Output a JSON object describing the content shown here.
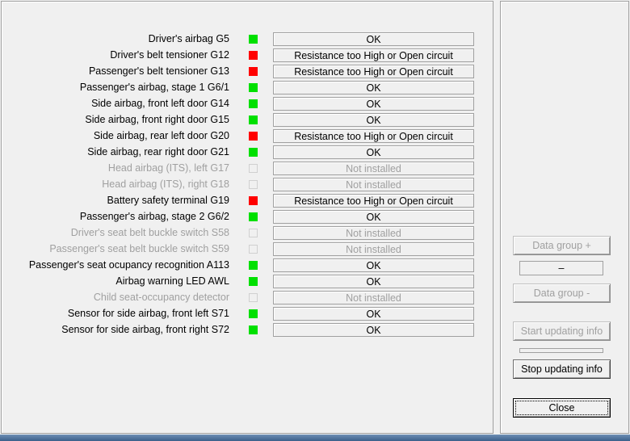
{
  "colors": {
    "ok": "#00e000",
    "error": "#ff0000",
    "not_installed": "#f0f0f0"
  },
  "rows": [
    {
      "label": "Driver's airbag G5",
      "status": "ok",
      "value": "OK"
    },
    {
      "label": "Driver's belt tensioner G12",
      "status": "error",
      "value": "Resistance too High or Open circuit"
    },
    {
      "label": "Passenger's belt tensioner G13",
      "status": "error",
      "value": "Resistance too High or Open circuit"
    },
    {
      "label": "Passenger's airbag, stage 1 G6/1",
      "status": "ok",
      "value": "OK"
    },
    {
      "label": "Side airbag, front left door G14",
      "status": "ok",
      "value": "OK"
    },
    {
      "label": "Side airbag, front right door G15",
      "status": "ok",
      "value": "OK"
    },
    {
      "label": "Side airbag, rear left door G20",
      "status": "error",
      "value": "Resistance too High or Open circuit"
    },
    {
      "label": "Side airbag, rear right door G21",
      "status": "ok",
      "value": "OK"
    },
    {
      "label": "Head airbag (ITS), left G17",
      "status": "not_installed",
      "value": "Not installed"
    },
    {
      "label": "Head airbag (ITS), right G18",
      "status": "not_installed",
      "value": "Not installed"
    },
    {
      "label": "Battery safety terminal G19",
      "status": "error",
      "value": "Resistance too High or Open circuit"
    },
    {
      "label": "Passenger's airbag, stage 2 G6/2",
      "status": "ok",
      "value": "OK"
    },
    {
      "label": "Driver's seat belt buckle switch S58",
      "status": "not_installed",
      "value": "Not installed"
    },
    {
      "label": "Passenger's seat belt buckle switch S59",
      "status": "not_installed",
      "value": "Not installed"
    },
    {
      "label": "Passenger's seat ocupancy recognition A113",
      "status": "ok",
      "value": "OK"
    },
    {
      "label": "Airbag warning LED AWL",
      "status": "ok",
      "value": "OK"
    },
    {
      "label": "Child seat-occupancy detector",
      "status": "not_installed",
      "value": "Not installed"
    },
    {
      "label": "Sensor for side airbag, front left S71",
      "status": "ok",
      "value": "OK"
    },
    {
      "label": "Sensor for side airbag, front right S72",
      "status": "ok",
      "value": "OK"
    }
  ],
  "controls": {
    "data_group_plus": "Data group +",
    "data_group_value": "–",
    "data_group_minus": "Data group -",
    "start_updating": "Start updating info",
    "stop_updating": "Stop updating info",
    "close": "Close"
  }
}
